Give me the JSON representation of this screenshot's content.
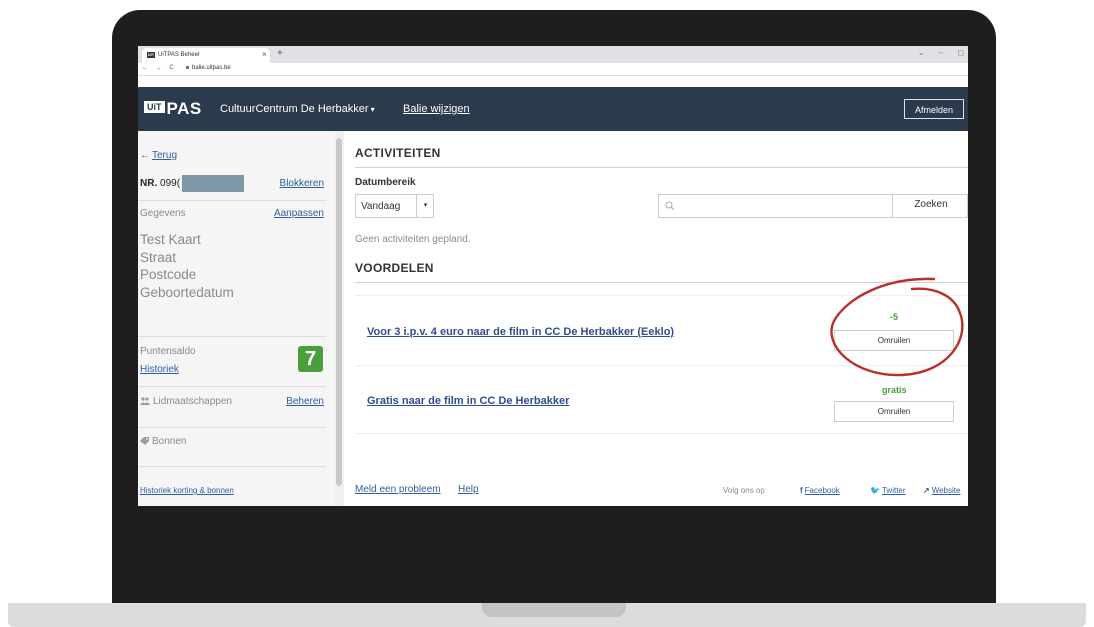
{
  "browser": {
    "tab_title": "UiTPAS Beheer",
    "tab_close": "×",
    "new_tab": "+",
    "window_controls": "⌄ – ◻",
    "nav_buttons": "← → C",
    "url": "balie.uitpas.be"
  },
  "header": {
    "logo_uit": "UiT",
    "logo_pas": "PAS",
    "organization": "CultuurCentrum De Herbakker",
    "organization_caret": "▾",
    "switch_counter": "Balie wijzigen",
    "logout": "Afmelden"
  },
  "sidebar": {
    "back": "Terug",
    "back_icon": "←",
    "number_label": "NR.",
    "number_visible": "099(",
    "block": "Blokkeren",
    "details_label": "Gegevens",
    "edit": "Aanpassen",
    "holder": [
      "Test Kaart",
      "Straat",
      "Postcode",
      "Geboortedatum"
    ],
    "points_label": "Puntensaldo",
    "points_value": "7",
    "history": "Historiek",
    "memberships_label": "Lidmaatschappen",
    "manage": "Beheren",
    "vouchers_label": "Bonnen",
    "history_footer": "Historiek korting & bonnen"
  },
  "activities": {
    "title": "ACTIVITEITEN",
    "date_range_label": "Datumbereik",
    "date_range_value": "Vandaag",
    "date_caret": "▾",
    "search_placeholder": "",
    "search_button": "Zoeken",
    "empty": "Geen activiteiten gepland."
  },
  "advantages": {
    "title": "VOORDELEN",
    "items": [
      {
        "title": "Voor 3 i.p.v. 4 euro naar de film in CC De Herbakker (Eeklo)",
        "points": "-5",
        "button": "Omruilen"
      },
      {
        "title": "Gratis naar de film in CC De Herbakker",
        "points": "gratis",
        "button": "Omruilen"
      }
    ]
  },
  "footer": {
    "report": "Meld een probleem",
    "help": "Help",
    "follow": "Volg ons op",
    "facebook_icon": "f",
    "facebook": "Facebook",
    "twitter_icon": "🐦",
    "twitter": "Twitter",
    "website_icon": "↗",
    "website": "Website"
  },
  "colors": {
    "header_bg": "#2b3a4d",
    "points_green": "#4a9f3c",
    "link_blue": "#2f5f9f",
    "highlight_red": "#b8302a"
  }
}
